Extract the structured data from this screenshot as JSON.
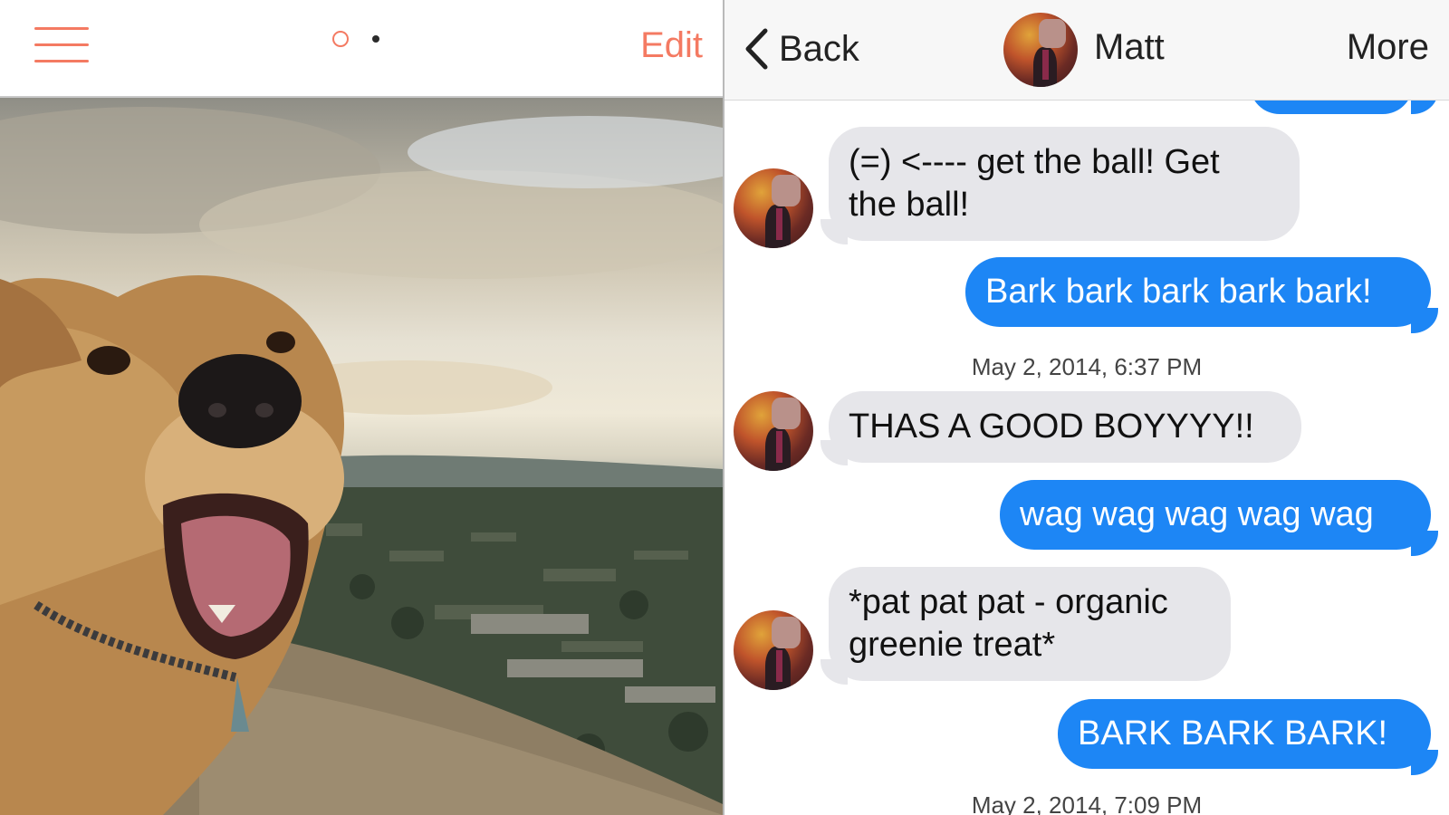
{
  "left": {
    "edit_label": "Edit",
    "accent_color": "#f47a62"
  },
  "chat": {
    "back_label": "Back",
    "contact_name": "Matt",
    "more_label": "More",
    "incoming_color": "#e6e6ea",
    "outgoing_color": "#1d86f5",
    "messages": [
      {
        "direction": "in",
        "text": "(=)  <---- get the ball! Get the ball!"
      },
      {
        "direction": "out",
        "text": "Bark bark bark bark bark!"
      },
      {
        "timestamp": "May 2, 2014, 6:37 PM"
      },
      {
        "direction": "in",
        "text": "THAS A GOOD BOYYYY!!"
      },
      {
        "direction": "out",
        "text": "wag wag wag wag wag"
      },
      {
        "direction": "in",
        "text": "*pat pat pat - organic greenie treat*"
      },
      {
        "direction": "out",
        "text": "BARK BARK BARK!"
      },
      {
        "timestamp": "May 2, 2014, 7:09 PM"
      }
    ]
  }
}
